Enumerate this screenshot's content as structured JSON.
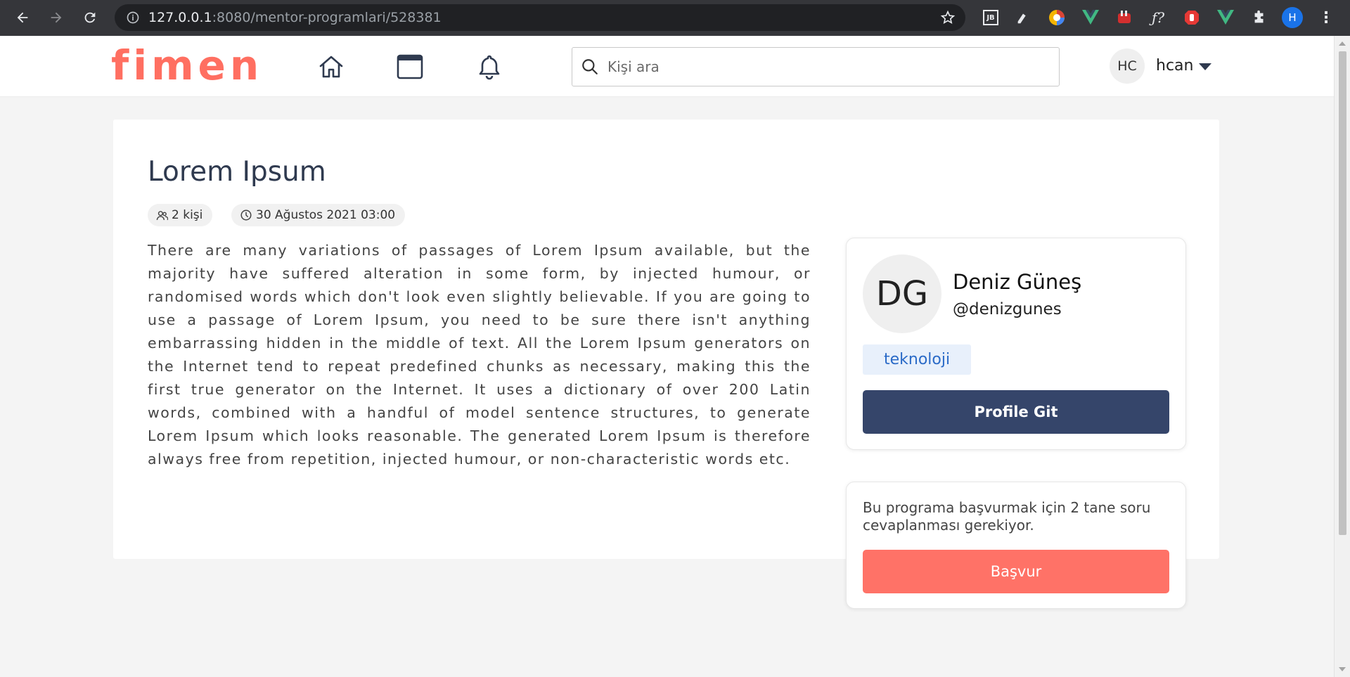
{
  "browser": {
    "url_host": "127.0.0.1",
    "url_rest": ":8080/mentor-programlari/528381",
    "extensions": [
      "jetbrains-icon",
      "pen-icon",
      "colorful-circle-icon",
      "vue-icon",
      "rabbit-icon",
      "fx-icon",
      "stop-hand-icon",
      "vue-icon",
      "puzzle-icon"
    ],
    "profile_initial": "H"
  },
  "header": {
    "logo": "fimen",
    "search_placeholder": "Kişi ara",
    "user_initials": "HC",
    "user_name": "hcan"
  },
  "program": {
    "title": "Lorem Ipsum",
    "participants": "2 kişi",
    "date": "30 Ağustos 2021 03:00",
    "description": "There are many variations of passages of Lorem Ipsum available, but the majority have suffered alteration in some form, by injected humour, or randomised words which don't look even slightly believable. If you are going to use a passage of Lorem Ipsum, you need to be sure there isn't anything embarrassing hidden in the middle of text. All the Lorem Ipsum generators on the Internet tend to repeat predefined chunks as necessary, making this the first true generator on the Internet. It uses a dictionary of over 200 Latin words, combined with a handful of model sentence structures, to generate Lorem Ipsum which looks reasonable. The generated Lorem Ipsum is therefore always free from repetition, injected humour, or non-characteristic words etc."
  },
  "mentor": {
    "initials": "DG",
    "name": "Deniz Güneş",
    "handle": "@denizgunes",
    "tag": "teknoloji",
    "profile_button": "Profile Git"
  },
  "apply": {
    "text": "Bu programa başvurmak için 2 tane soru cevaplanması gerekiyor.",
    "button": "Başvur"
  },
  "colors": {
    "brand": "#ff6f61",
    "navy": "#35456a",
    "tag_text": "#2a6ac7"
  }
}
